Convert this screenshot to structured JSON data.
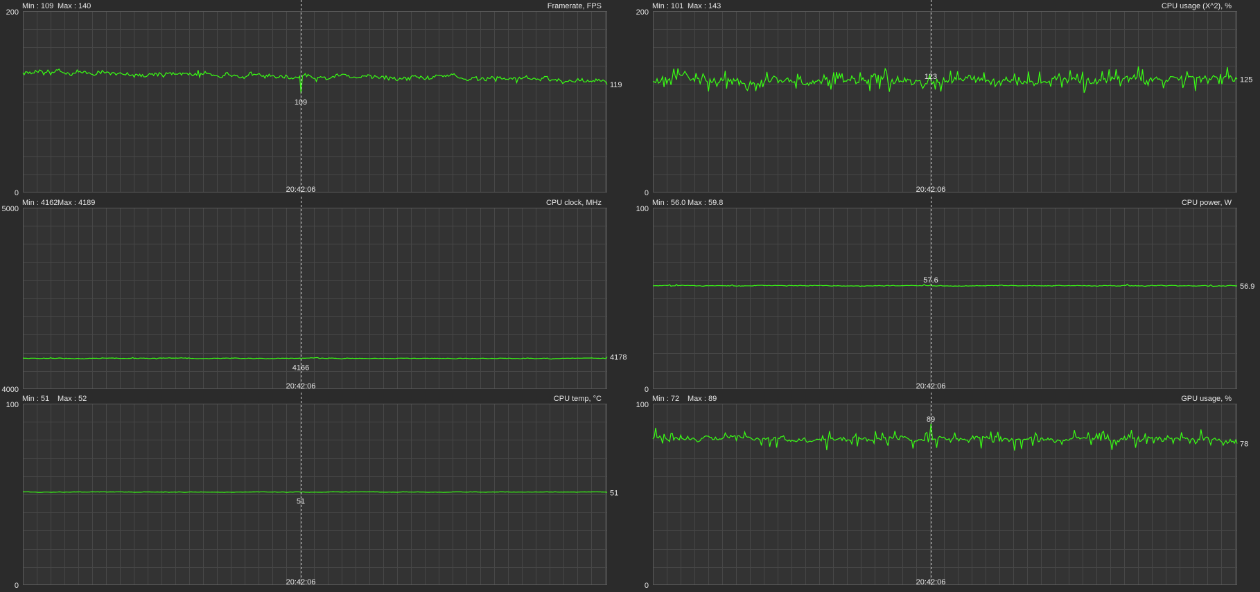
{
  "window": {
    "background": "#2b2b2b"
  },
  "colors": {
    "plot_bg": "#333333",
    "grid": "#474747",
    "grid_edge": "#5a5a5a",
    "line": "#39ff14",
    "text": "#e6e6e6",
    "cursor": "#d8d8d8"
  },
  "cursor": {
    "time": "20:42:06"
  },
  "graphs": [
    {
      "id": "framerate",
      "title": "Framerate, FPS",
      "min_label": "Min : 109",
      "max_label": "Max : 140",
      "ymin": 0,
      "ymax": 200,
      "ymin_label": "0",
      "ymax_label": "200",
      "cursor_value": "109",
      "current_value": "119",
      "cursor_val": 109,
      "current_val": 119,
      "center": 133,
      "trend": -10,
      "noise": 3,
      "spikes": 4,
      "spike_p": 0.08
    },
    {
      "id": "cpu-usage",
      "title": "CPU usage (X^2), %",
      "min_label": "Min : 101",
      "max_label": "Max : 143",
      "ymin": 0,
      "ymax": 200,
      "ymin_label": "0",
      "ymax_label": "200",
      "cursor_value": "123",
      "current_value": "125",
      "cursor_val": 123,
      "current_val": 125,
      "center": 124,
      "trend": 0,
      "noise": 5,
      "spikes": 12,
      "spike_p": 0.3
    },
    {
      "id": "cpu-clock",
      "title": "CPU clock, MHz",
      "min_label": "Min : 4162",
      "max_label": "Max : 4189",
      "ymin": 4000,
      "ymax": 5000,
      "ymin_label": "4000",
      "ymax_label": "5000",
      "cursor_value": "4166",
      "current_value": "4178",
      "cursor_val": 4166,
      "current_val": 4178,
      "center": 4170,
      "trend": 0,
      "noise": 2,
      "spikes": 3,
      "spike_p": 0.05
    },
    {
      "id": "cpu-power",
      "title": "CPU power, W",
      "min_label": "Min : 56.0",
      "max_label": "Max : 59.8",
      "ymin": 0,
      "ymax": 100,
      "ymin_label": "0",
      "ymax_label": "100",
      "cursor_value": "57.6",
      "current_value": "56.9",
      "cursor_val": 57.6,
      "current_val": 56.9,
      "center": 57,
      "trend": 0,
      "noise": 0.25,
      "spikes": 0.8,
      "spike_p": 0.03
    },
    {
      "id": "cpu-temp",
      "title": "CPU temp, °C",
      "min_label": "Min : 51",
      "max_label": "Max : 52",
      "ymin": 0,
      "ymax": 100,
      "ymin_label": "0",
      "ymax_label": "100",
      "cursor_value": "51",
      "current_value": "51",
      "cursor_val": 51,
      "current_val": 51,
      "center": 51.3,
      "trend": 0,
      "noise": 0.15,
      "spikes": 0,
      "spike_p": 0
    },
    {
      "id": "gpu-usage",
      "title": "GPU usage, %",
      "min_label": "Min : 72",
      "max_label": "Max : 89",
      "ymin": 0,
      "ymax": 100,
      "ymin_label": "0",
      "ymax_label": "100",
      "cursor_value": "89",
      "current_value": "78",
      "cursor_val": 89,
      "current_val": 78,
      "center": 81,
      "trend": -1,
      "noise": 1.5,
      "spikes": 5,
      "spike_p": 0.25
    }
  ]
}
